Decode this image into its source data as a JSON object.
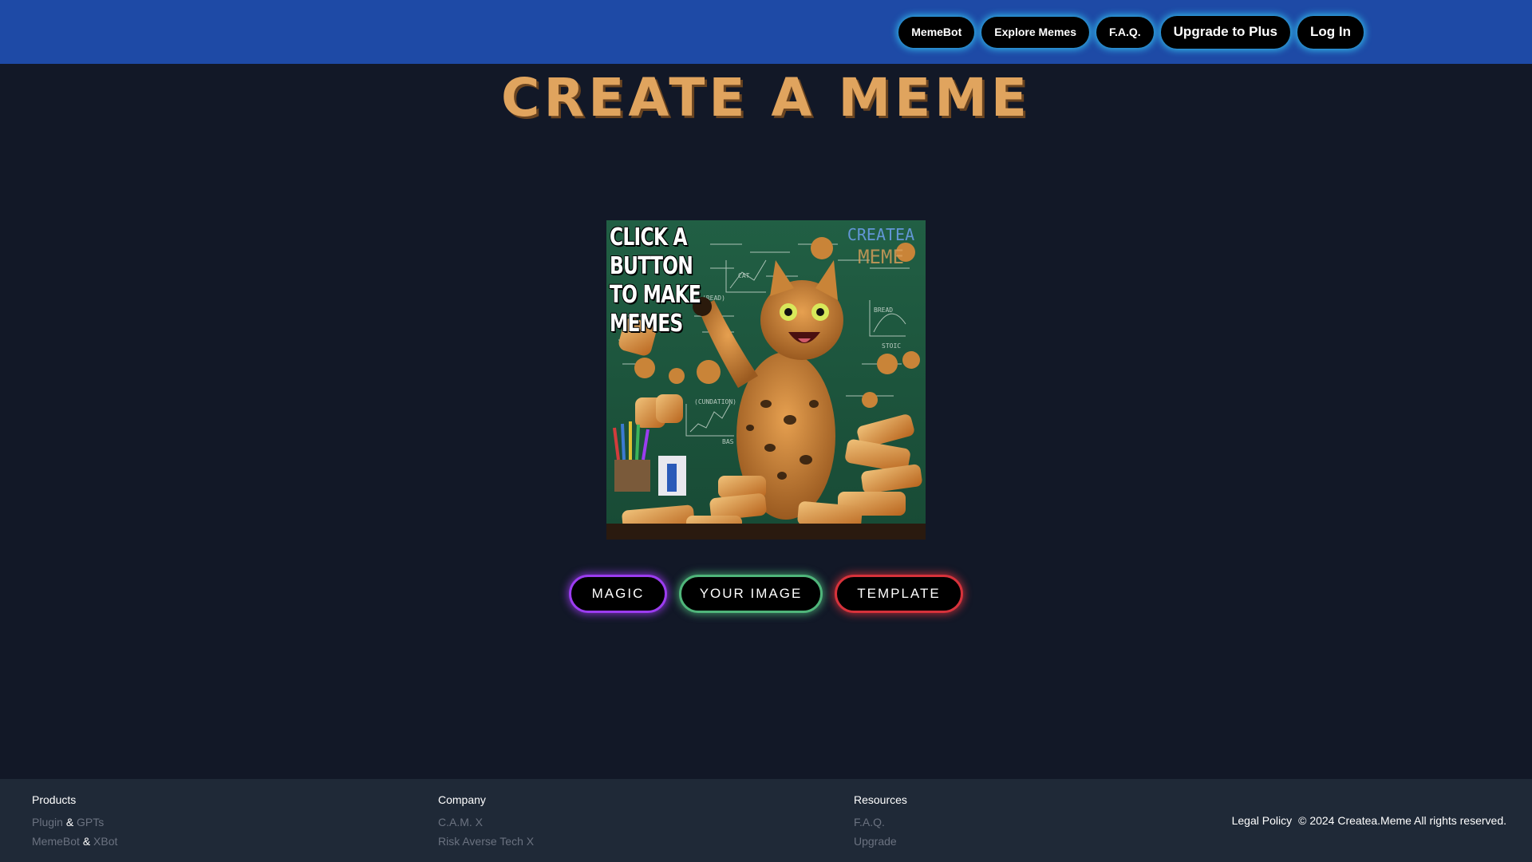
{
  "header": {
    "nav": [
      {
        "label": "MemeBot",
        "name": "nav-memebot-button"
      },
      {
        "label": "Explore Memes",
        "name": "nav-explore-memes-button"
      },
      {
        "label": "F.A.Q.",
        "name": "nav-faq-button"
      },
      {
        "label": "Upgrade to Plus",
        "name": "nav-upgrade-button"
      },
      {
        "label": "Log In",
        "name": "nav-login-button"
      }
    ]
  },
  "main": {
    "title": "Create a Meme",
    "image": {
      "caption_lines": [
        "CLICK A BUTTON",
        "TO MAKE",
        "MEMES"
      ],
      "watermark_1": "CREATEA",
      "watermark_2": "MEME"
    },
    "actions": {
      "magic": "MAGIC",
      "your_image": "YOUR IMAGE",
      "template": "TEMPLATE"
    }
  },
  "footer": {
    "products": {
      "heading": "Products",
      "row1": {
        "a": "Plugin",
        "amp": "&",
        "b": "GPTs"
      },
      "row2": {
        "a": "MemeBot",
        "amp": "&",
        "b": "XBot"
      }
    },
    "company": {
      "heading": "Company",
      "links": [
        "C.A.M. X",
        "Risk Averse Tech X"
      ]
    },
    "resources": {
      "heading": "Resources",
      "links": [
        "F.A.Q.",
        "Upgrade"
      ]
    },
    "legal": "Legal Policy",
    "copyright": "© 2024 Createa.Meme All rights reserved."
  },
  "colors": {
    "header_bg": "#1e4aa6",
    "page_bg": "#121827",
    "footer_bg": "#1f2937",
    "title": "#e0a45e",
    "nav_glow": "#38dcff",
    "magic": "#9b3cf0",
    "your_image": "#4fb57a",
    "template": "#d7323b"
  }
}
